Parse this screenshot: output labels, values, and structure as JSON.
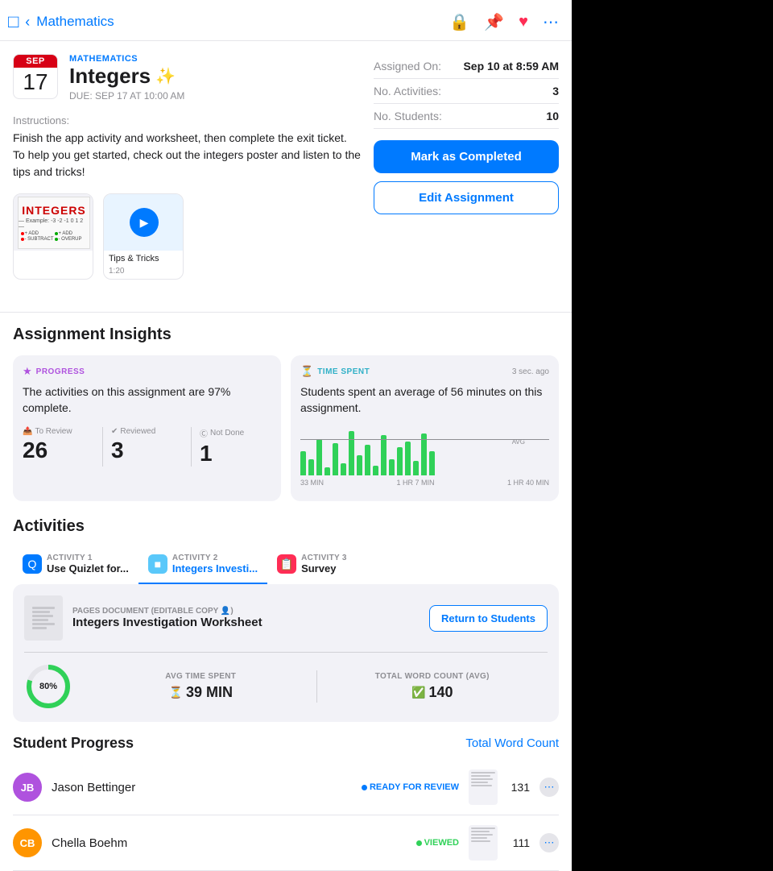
{
  "nav": {
    "back_label": "Mathematics",
    "icons": [
      "lock",
      "pin",
      "heart",
      "more"
    ]
  },
  "assignment": {
    "date_month": "SEP",
    "date_day": "17",
    "subject_label": "MATHEMATICS",
    "title": "Integers",
    "sparkle": "✨",
    "due_label": "DUE: SEP 17 AT 10:00 AM",
    "instructions_label": "Instructions:",
    "instructions_text": "Finish the app activity and worksheet, then complete the exit ticket. To help you get started, check out the integers poster and listen to the tips and tricks!",
    "attachments": [
      {
        "label": "Integers Poster",
        "sublabel": ""
      },
      {
        "label": "Tips & Tricks",
        "sublabel": "1:20"
      }
    ]
  },
  "meta": {
    "assigned_on_label": "Assigned On:",
    "assigned_on_value": "Sep 10 at 8:59 AM",
    "no_activities_label": "No. Activities:",
    "no_activities_value": "3",
    "no_students_label": "No. Students:",
    "no_students_value": "10"
  },
  "buttons": {
    "mark_completed": "Mark as Completed",
    "edit_assignment": "Edit Assignment"
  },
  "insights": {
    "title": "Assignment Insights",
    "progress": {
      "category": "PROGRESS",
      "text": "The activities on this assignment are 97% complete.",
      "stats": [
        {
          "label": "To Review",
          "value": "26"
        },
        {
          "label": "Reviewed",
          "value": "3"
        },
        {
          "label": "Not Done",
          "value": "1"
        }
      ]
    },
    "time_spent": {
      "category": "TIME SPENT",
      "timestamp": "3 sec. ago",
      "text": "Students spent an average of 56 minutes on this assignment.",
      "chart_labels": [
        "33 MIN",
        "1 HR 7 MIN",
        "1 HR 40 MIN"
      ],
      "chart_y": [
        "1",
        "0"
      ]
    }
  },
  "activities": {
    "title": "Activities",
    "tabs": [
      {
        "number": "ACTIVITY 1",
        "name": "Use Quizlet for..."
      },
      {
        "number": "ACTIVITY 2",
        "name": "Integers Investi..."
      },
      {
        "number": "ACTIVITY 3",
        "name": "Survey"
      }
    ],
    "doc": {
      "type": "PAGES DOCUMENT (EDITABLE COPY 👤)",
      "name": "Integers Investigation Worksheet",
      "return_btn": "Return to Students"
    },
    "metrics": {
      "progress_pct": "80%",
      "avg_time_label": "AVG TIME SPENT",
      "avg_time_value": "39 MIN",
      "word_count_label": "TOTAL WORD COUNT (AVG)",
      "word_count_value": "140"
    }
  },
  "student_progress": {
    "title": "Student Progress",
    "total_word_count_link": "Total Word Count",
    "students": [
      {
        "initials": "JB",
        "name": "Jason Bettinger",
        "status": "READY FOR REVIEW",
        "status_type": "review",
        "word_count": "131"
      },
      {
        "initials": "CB",
        "name": "Chella Boehm",
        "status": "VIEWED",
        "status_type": "viewed",
        "word_count": "111"
      }
    ]
  }
}
